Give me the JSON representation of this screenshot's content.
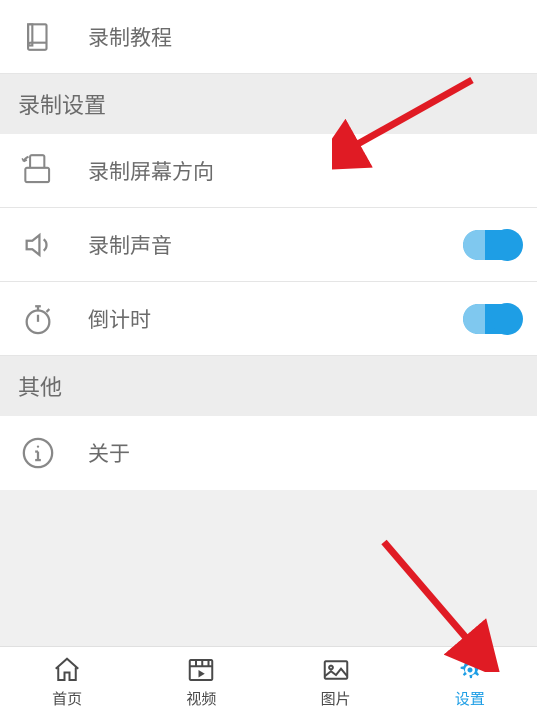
{
  "items": {
    "tutorial": "录制教程",
    "orientation": "录制屏幕方向",
    "sound": "录制声音",
    "countdown": "倒计时",
    "about": "关于"
  },
  "sections": {
    "recordSettings": "录制设置",
    "other": "其他"
  },
  "toggles": {
    "sound": true,
    "countdown": true
  },
  "nav": {
    "home": "首页",
    "video": "视频",
    "picture": "图片",
    "settings": "设置"
  }
}
